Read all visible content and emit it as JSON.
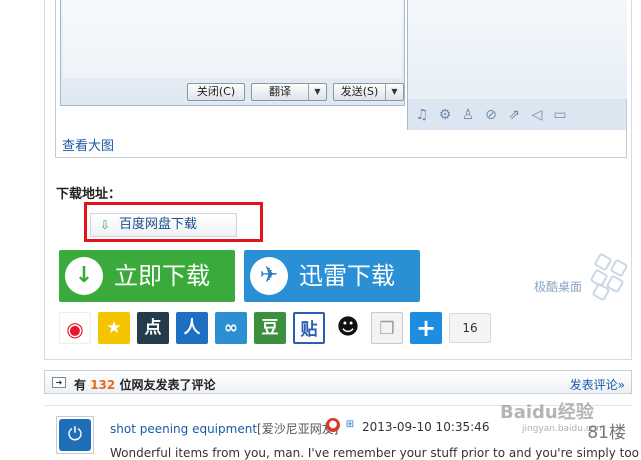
{
  "chat_window": {
    "close_label": "关闭(C)",
    "translate_label": "翻译",
    "send_label": "发送(S)"
  },
  "view_large_label": "查看大图",
  "download": {
    "title": "下载地址：",
    "pan_label": "百度网盘下载",
    "now_label": "立即下载",
    "xunlei_label": "迅雷下载"
  },
  "brand_logo_text": "极酷桌面",
  "share": {
    "count": "16",
    "icons": [
      "weibo-icon",
      "qzone-icon",
      "dianping-icon",
      "renren-icon",
      "pengyou-icon",
      "douban-icon",
      "tieba-icon",
      "qq-icon",
      "copy-icon",
      "more-icon"
    ]
  },
  "comments_header": {
    "prefix": "有",
    "count": "132",
    "suffix": "位网友发表了评论",
    "post_label": "发表评论»"
  },
  "comment": {
    "author": "shot peening equipment",
    "location": "[爱沙尼亚网友]",
    "date": "2013-09-10 10:35:46",
    "floor": "81楼",
    "text": "Wonderful items from you, man. I've remember your stuff prior to and you're simply too"
  },
  "watermark": {
    "main": "Baidu经验",
    "sub": "jingyan.baidu.com"
  },
  "colors": {
    "green": "#3aab3a",
    "blue": "#2a90d6",
    "red_box": "#e2141a",
    "link": "#1a5aa8",
    "count_orange": "#e96a1b"
  }
}
